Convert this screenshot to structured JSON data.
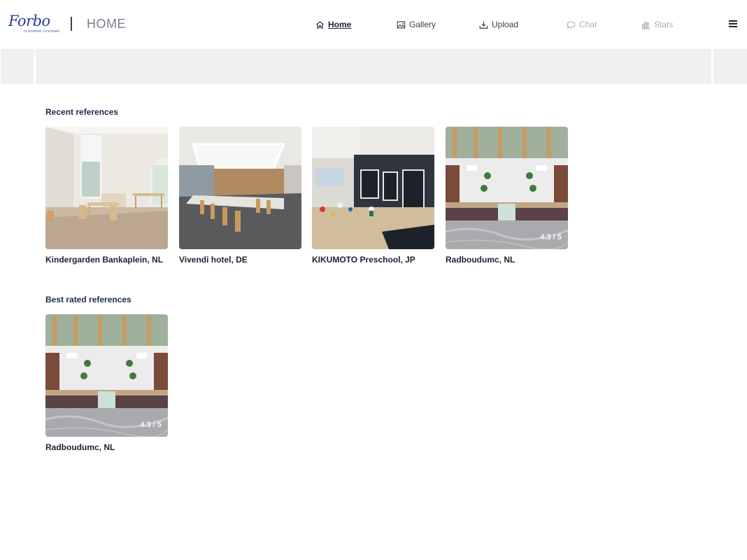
{
  "brand": {
    "logo_word": "Forbo",
    "logo_sub": "FLOORING SYSTEMS",
    "page_title": "HOME"
  },
  "nav": {
    "items": [
      {
        "label": "Home",
        "icon": "home-icon",
        "state": "active"
      },
      {
        "label": "Gallery",
        "icon": "image-icon",
        "state": "enabled"
      },
      {
        "label": "Upload",
        "icon": "upload-icon",
        "state": "enabled"
      },
      {
        "label": "Chat",
        "icon": "chat-icon",
        "state": "disabled"
      },
      {
        "label": "Stats",
        "icon": "bar-chart-icon",
        "state": "disabled"
      }
    ],
    "menu_icon": "hamburger-icon"
  },
  "recent": {
    "title": "Recent references",
    "cards": [
      {
        "label": "Kindergarden Bankaplein, NL",
        "rating": ""
      },
      {
        "label": "Vivendi hotel, DE",
        "rating": ""
      },
      {
        "label": "KIKUMOTO Preschool, JP",
        "rating": ""
      },
      {
        "label": "Radboudumc, NL",
        "rating": "4.3 / 5"
      }
    ]
  },
  "best": {
    "title": "Best rated references",
    "cards": [
      {
        "label": "Radboudumc, NL",
        "rating": "4.3 / 5"
      }
    ]
  },
  "colors": {
    "brand_blue": "#2a3d9a",
    "banner_gray": "#eff0f2",
    "text_dark": "#1c2233",
    "nav_disabled": "#a9adb6"
  }
}
